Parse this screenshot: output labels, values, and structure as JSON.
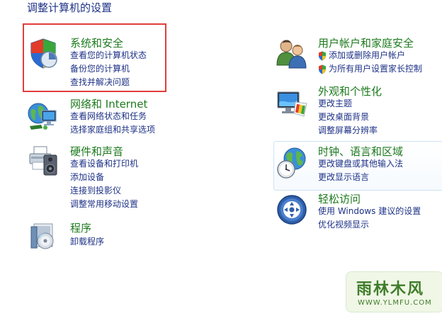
{
  "page": {
    "title": "调整计算机的设置"
  },
  "categories": {
    "system_security": {
      "title": "系统和安全",
      "links": [
        "查看您的计算机状态",
        "备份您的计算机",
        "查找并解决问题"
      ]
    },
    "network": {
      "title": "网络和 Internet",
      "links": [
        "查看网络状态和任务",
        "选择家庭组和共享选项"
      ]
    },
    "hardware": {
      "title": "硬件和声音",
      "links": [
        "查看设备和打印机",
        "添加设备",
        "连接到投影仪",
        "调整常用移动设置"
      ]
    },
    "programs": {
      "title": "程序",
      "links": [
        "卸载程序"
      ]
    },
    "user_accounts": {
      "title": "用户帐户和家庭安全",
      "links": [
        "添加或删除用户帐户",
        "为所有用户设置家长控制"
      ]
    },
    "appearance": {
      "title": "外观和个性化",
      "links": [
        "更改主题",
        "更改桌面背景",
        "调整屏幕分辨率"
      ]
    },
    "clock_region": {
      "title": "时钟、语言和区域",
      "links": [
        "更改键盘或其他输入法",
        "更改显示语言"
      ]
    },
    "ease_access": {
      "title": "轻松访问",
      "links": [
        "使用 Windows 建议的设置",
        "优化视频显示"
      ]
    }
  },
  "watermark": {
    "main": "雨林木风",
    "sub": "WWW.YLMFU.COM"
  },
  "colors": {
    "link": "#1e3287",
    "category_title": "#1d7a1d",
    "highlight": "#e23d3d"
  }
}
